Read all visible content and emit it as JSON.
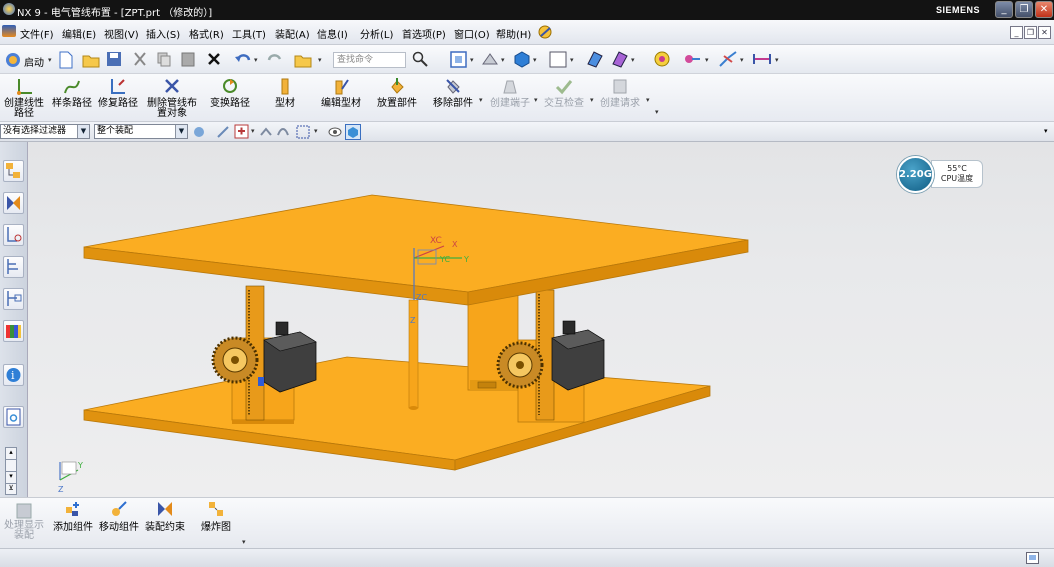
{
  "window": {
    "title": "NX 9 - 电气管线布置 - [ZPT.prt （修改的）]",
    "brand": "SIEMENS",
    "buttons": {
      "minimize": "_",
      "restore": "❐",
      "close": "✕"
    }
  },
  "menu": {
    "items": [
      "文件(F)",
      "编辑(E)",
      "视图(V)",
      "插入(S)",
      "格式(R)",
      "工具(T)",
      "装配(A)",
      "信息(I)",
      "分析(L)",
      "首选项(P)",
      "窗口(O)",
      "帮助(H)"
    ]
  },
  "toolbar": {
    "start_label": "启动",
    "search_placeholder": "查找命令"
  },
  "ribbon": {
    "buttons": [
      {
        "label": "创建线性路径",
        "enabled": true
      },
      {
        "label": "样条路径",
        "enabled": true
      },
      {
        "label": "修复路径",
        "enabled": true
      },
      {
        "label": "删除管线布置对象",
        "enabled": true
      },
      {
        "label": "变换路径",
        "enabled": true
      },
      {
        "label": "型材",
        "enabled": true
      },
      {
        "label": "编辑型材",
        "enabled": true
      },
      {
        "label": "放置部件",
        "enabled": true
      },
      {
        "label": "移除部件",
        "enabled": true
      },
      {
        "label": "创建端子",
        "enabled": false
      },
      {
        "label": "交互检查",
        "enabled": false
      },
      {
        "label": "创建请求",
        "enabled": false
      }
    ]
  },
  "selection_bar": {
    "filter_value": "没有选择过滤器",
    "scope_value": "整个装配"
  },
  "viewport": {
    "colors": {
      "plate": "#f7a51b",
      "plate_top": "#fbad22",
      "plate_edge": "#d98a0a",
      "motor": "#3f3f3f",
      "background": "#e6e7e9"
    },
    "triad_labels": {
      "xc": "XC",
      "yc": "YC",
      "zc": "ZC",
      "z": "Z",
      "y": "Y",
      "x": "X"
    }
  },
  "cpu_widget": {
    "frequency": "2.20G",
    "temperature": "55°C",
    "label": "CPU温度"
  },
  "bottom_toolbar": {
    "buttons": [
      {
        "label": "处理显示装配",
        "enabled": false
      },
      {
        "label": "添加组件",
        "enabled": true
      },
      {
        "label": "移动组件",
        "enabled": true
      },
      {
        "label": "装配约束",
        "enabled": true
      },
      {
        "label": "爆炸图",
        "enabled": true
      }
    ]
  }
}
